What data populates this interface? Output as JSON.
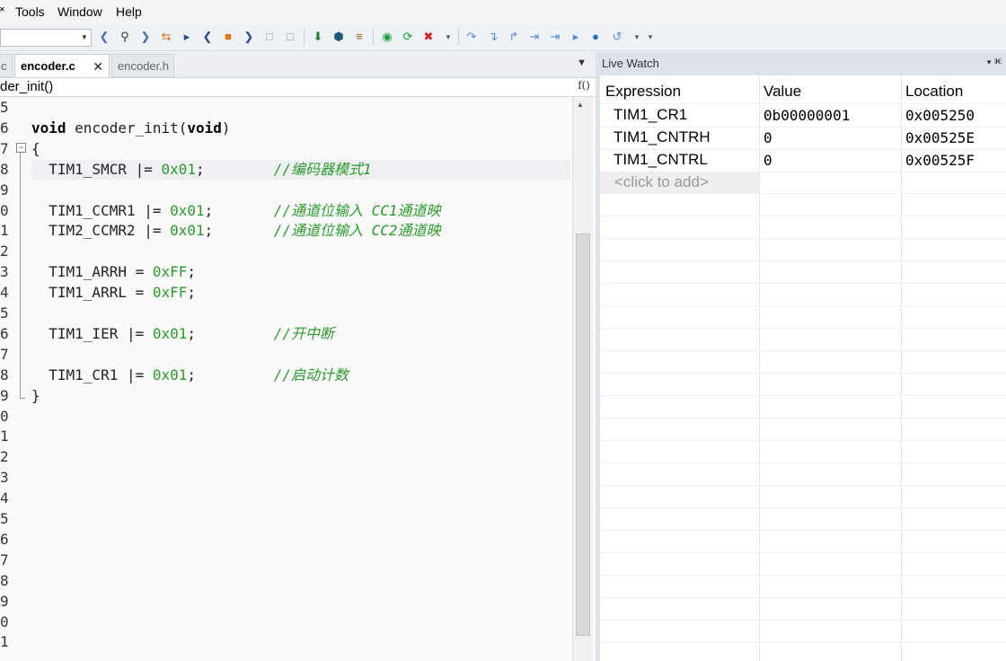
{
  "menu": [
    "Tools",
    "Window",
    "Help"
  ],
  "menu_partial": "˟",
  "toolbar": {
    "icons": [
      "chevron-left-icon",
      "search-icon",
      "chevron-right-icon",
      "toggle-bookmark-icon",
      "next-bookmark-icon",
      "previous-icon",
      "insert-breakpoint-icon",
      "next-icon",
      "prev-file-icon",
      "next-file-icon",
      "download-icon",
      "upload-icon",
      "list-icon",
      "go-icon",
      "reset-icon",
      "stop-icon",
      "step-over-icon",
      "step-into-icon",
      "step-out-icon",
      "run-to-cursor-icon",
      "next-statement-icon",
      "run-icon",
      "break-icon",
      "more-icon"
    ]
  },
  "tabs": [
    {
      "label": "c",
      "active": false
    },
    {
      "label": "encoder.c",
      "active": true,
      "close": "✕"
    },
    {
      "label": "encoder.h",
      "active": false
    }
  ],
  "function_bar": {
    "name": "der_init()",
    "fx": "f()"
  },
  "code": {
    "line_numbers": [
      "5",
      "6",
      "7",
      "8",
      "9",
      "0",
      "1",
      "2",
      "3",
      "4",
      "5",
      "6",
      "7",
      "8",
      "9",
      "0",
      "1",
      "2",
      "3",
      "4",
      "5",
      "6",
      "7",
      "8",
      "9",
      "0",
      "1"
    ],
    "lines": [
      {
        "parts": []
      },
      {
        "parts": [
          {
            "t": "void",
            "c": "kw"
          },
          {
            "t": " encoder_init(",
            "c": ""
          },
          {
            "t": "void",
            "c": "kw"
          },
          {
            "t": ")",
            "c": ""
          }
        ]
      },
      {
        "parts": [
          {
            "t": "{",
            "c": ""
          }
        ]
      },
      {
        "parts": [
          {
            "t": "  TIM1_SMCR |= ",
            "c": ""
          },
          {
            "t": "0x01",
            "c": "num"
          },
          {
            "t": ";        ",
            "c": ""
          },
          {
            "t": "//编码器模式1",
            "c": "cmt"
          }
        ]
      },
      {
        "parts": []
      },
      {
        "parts": [
          {
            "t": "  TIM1_CCMR1 |= ",
            "c": ""
          },
          {
            "t": "0x01",
            "c": "num"
          },
          {
            "t": ";       ",
            "c": ""
          },
          {
            "t": "//通道位输入 CC1通道映",
            "c": "cmt"
          }
        ]
      },
      {
        "parts": [
          {
            "t": "  TIM2_CCMR2 |= ",
            "c": ""
          },
          {
            "t": "0x01",
            "c": "num"
          },
          {
            "t": ";       ",
            "c": ""
          },
          {
            "t": "//通道位输入 CC2通道映",
            "c": "cmt"
          }
        ]
      },
      {
        "parts": []
      },
      {
        "parts": [
          {
            "t": "  TIM1_ARRH = ",
            "c": ""
          },
          {
            "t": "0xFF",
            "c": "num"
          },
          {
            "t": ";",
            "c": ""
          }
        ]
      },
      {
        "parts": [
          {
            "t": "  TIM1_ARRL = ",
            "c": ""
          },
          {
            "t": "0xFF",
            "c": "num"
          },
          {
            "t": ";",
            "c": ""
          }
        ]
      },
      {
        "parts": []
      },
      {
        "parts": [
          {
            "t": "  TIM1_IER |= ",
            "c": ""
          },
          {
            "t": "0x01",
            "c": "num"
          },
          {
            "t": ";         ",
            "c": ""
          },
          {
            "t": "//开中断",
            "c": "cmt"
          }
        ]
      },
      {
        "parts": []
      },
      {
        "parts": [
          {
            "t": "  TIM1_CR1 |= ",
            "c": ""
          },
          {
            "t": "0x01",
            "c": "num"
          },
          {
            "t": ";         ",
            "c": ""
          },
          {
            "t": "//启动计数",
            "c": "cmt"
          }
        ]
      },
      {
        "parts": [
          {
            "t": "}",
            "c": ""
          }
        ]
      }
    ]
  },
  "watch": {
    "title": "Live Watch",
    "pin": "▾ ⱘ",
    "columns": [
      "Expression",
      "Value",
      "Location"
    ],
    "rows": [
      {
        "expression": "TIM1_CR1",
        "value": "0b00000001",
        "location": "0x005250"
      },
      {
        "expression": "TIM1_CNTRH",
        "value": "0",
        "location": "0x00525E"
      },
      {
        "expression": "TIM1_CNTRL",
        "value": "0",
        "location": "0x00525F"
      }
    ],
    "add_placeholder": "<click to add>"
  },
  "colors": {
    "accent_green": "#2c9a2c",
    "panel_title_bg": "#dde2ea"
  }
}
